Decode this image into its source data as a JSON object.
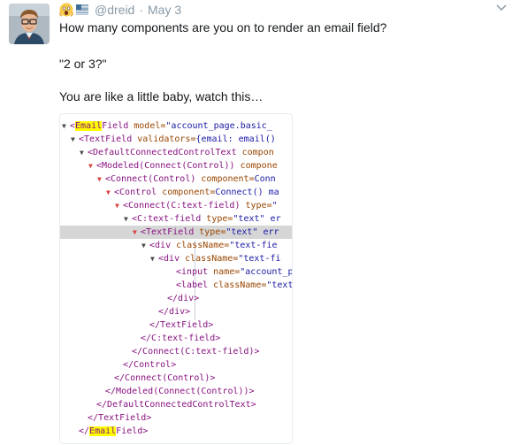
{
  "tweet": {
    "handle": "@dreid",
    "separator": "·",
    "date": "May 3",
    "lines": [
      "How many components are you on to render an email field?",
      "\"2 or 3?\"",
      "You are like a little baby, watch this…"
    ]
  },
  "code": [
    {
      "tri": "▼",
      "red": false,
      "pre": "<",
      "hl": "Email",
      "name": "Field",
      "attr": " model=",
      "val": "\"account_page.basic_"
    },
    {
      "tri": "▼",
      "red": false,
      "pre": "<",
      "hl": "",
      "name": "TextField",
      "attr": " validators=",
      "val": "{email: email()"
    },
    {
      "tri": "▼",
      "red": false,
      "pre": "<",
      "hl": "",
      "name": "DefaultConnectedControlText",
      "attr": " compon",
      "val": ""
    },
    {
      "tri": "▼",
      "red": true,
      "pre": "<",
      "hl": "",
      "name": "Modeled(Connect(Control))",
      "attr": " compone",
      "val": ""
    },
    {
      "tri": "▼",
      "red": true,
      "pre": "<",
      "hl": "",
      "name": "Connect(Control)",
      "attr": " component=",
      "val": "Conn"
    },
    {
      "tri": "▼",
      "red": true,
      "pre": "<",
      "hl": "",
      "name": "Control",
      "attr": " component=",
      "val": "Connect() ma"
    },
    {
      "tri": "▼",
      "red": true,
      "pre": "<",
      "hl": "",
      "name": "Connect(C:text-field)",
      "attr": " type=",
      "val": "\""
    },
    {
      "tri": "▼",
      "red": false,
      "pre": "<",
      "hl": "",
      "name": "C:text-field",
      "attr": " type=",
      "val": "\"text\" er"
    },
    {
      "tri": "▼",
      "red": true,
      "pre": "<",
      "hl": "",
      "name": "TextField",
      "attr": " type=",
      "val": "\"text\" err"
    },
    {
      "tri": "▼",
      "red": false,
      "pre": "<",
      "hl": "",
      "name": "div",
      "attr": " className=",
      "val": "\"text-fie"
    },
    {
      "tri": "▼",
      "red": false,
      "pre": "<",
      "hl": "",
      "name": "div",
      "attr": " className=",
      "val": "\"text-fi"
    },
    {
      "tri": "",
      "red": false,
      "pre": "<",
      "hl": "",
      "name": "input",
      "attr": " name=",
      "val": "\"account_p"
    },
    {
      "tri": "",
      "red": false,
      "pre": "<",
      "hl": "",
      "name": "label",
      "attr": " className=",
      "val": "\"text"
    },
    {
      "tri": "",
      "red": false,
      "pre": "</",
      "hl": "",
      "name": "div>",
      "attr": "",
      "val": ""
    },
    {
      "tri": "",
      "red": false,
      "pre": "</",
      "hl": "",
      "name": "div>",
      "attr": "",
      "val": ""
    },
    {
      "tri": "",
      "red": false,
      "pre": "</",
      "hl": "",
      "name": "TextField>",
      "attr": "",
      "val": ""
    },
    {
      "tri": "",
      "red": false,
      "pre": "</",
      "hl": "",
      "name": "C:text-field>",
      "attr": "",
      "val": ""
    },
    {
      "tri": "",
      "red": false,
      "pre": "</",
      "hl": "",
      "name": "Connect(C:text-field)>",
      "attr": "",
      "val": ""
    },
    {
      "tri": "",
      "red": false,
      "pre": "</",
      "hl": "",
      "name": "Control>",
      "attr": "",
      "val": ""
    },
    {
      "tri": "",
      "red": false,
      "pre": "</",
      "hl": "",
      "name": "Connect(Control)>",
      "attr": "",
      "val": ""
    },
    {
      "tri": "",
      "red": false,
      "pre": "</",
      "hl": "",
      "name": "Modeled(Connect(Control))>",
      "attr": "",
      "val": ""
    },
    {
      "tri": "",
      "red": false,
      "pre": "</",
      "hl": "",
      "name": "DefaultConnectedControlText>",
      "attr": "",
      "val": ""
    },
    {
      "tri": "",
      "red": false,
      "pre": "</",
      "hl": "",
      "name": "TextField>",
      "attr": "",
      "val": ""
    },
    {
      "tri": "",
      "red": false,
      "pre": "</",
      "hl": "Email",
      "name": "Field>",
      "attr": "",
      "val": ""
    }
  ],
  "selected_line": 8,
  "icons": {
    "avatar": "avatar-photo",
    "emoji": "screaming-face-icon",
    "flag": "flag-icon",
    "caret": "chevron-down-icon"
  }
}
